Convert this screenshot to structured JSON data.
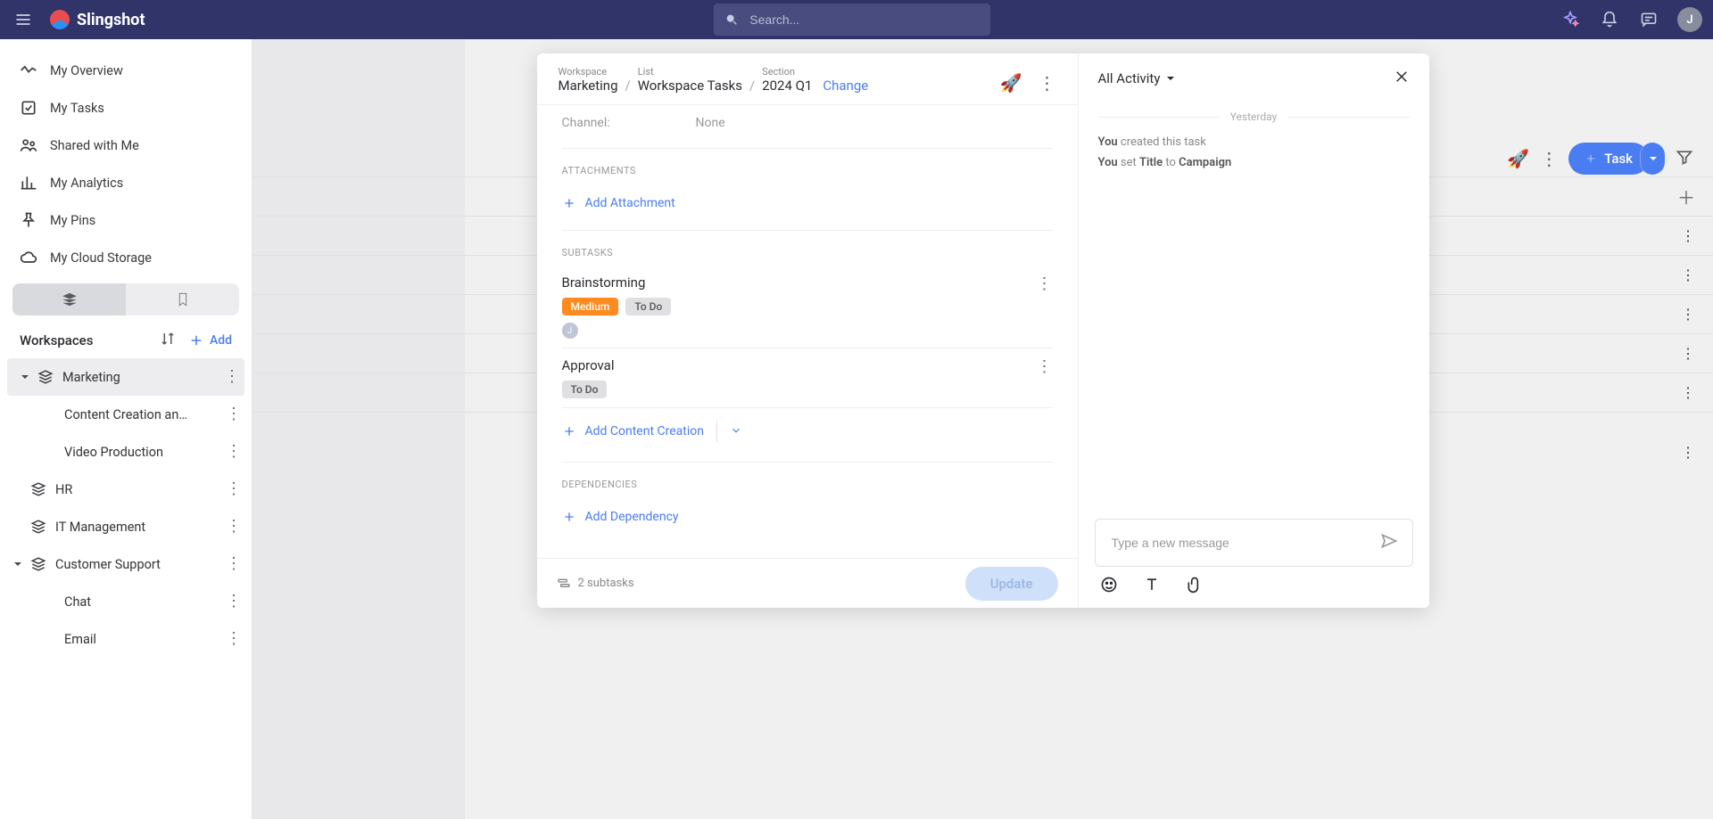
{
  "brand": {
    "name": "Slingshot"
  },
  "search": {
    "placeholder": "Search..."
  },
  "user": {
    "initial": "J"
  },
  "nav": [
    {
      "label": "My Overview",
      "icon": "activity"
    },
    {
      "label": "My Tasks",
      "icon": "check-square"
    },
    {
      "label": "Shared with Me",
      "icon": "users"
    },
    {
      "label": "My Analytics",
      "icon": "bar-chart"
    },
    {
      "label": "My Pins",
      "icon": "pin"
    },
    {
      "label": "My Cloud Storage",
      "icon": "cloud"
    }
  ],
  "workspaces_header": {
    "title": "Workspaces",
    "add": "Add"
  },
  "workspaces": [
    {
      "label": "Marketing",
      "expanded": true,
      "active": true,
      "children": [
        {
          "label": "Content Creation an…"
        },
        {
          "label": "Video Production"
        }
      ]
    },
    {
      "label": "HR",
      "expanded": false,
      "children": []
    },
    {
      "label": "IT Management",
      "expanded": false,
      "children": []
    },
    {
      "label": "Customer Support",
      "expanded": true,
      "children": [
        {
          "label": "Chat"
        },
        {
          "label": "Email"
        }
      ]
    }
  ],
  "bg_toolbar": {
    "task_button": "Task"
  },
  "modal": {
    "breadcrumb": {
      "workspace_label": "Workspace",
      "workspace": "Marketing",
      "list_label": "List",
      "list": "Workspace Tasks",
      "section_label": "Section",
      "section": "2024 Q1"
    },
    "change": "Change",
    "fields": {
      "channel_label": "Channel:",
      "channel_value": "None"
    },
    "sections": {
      "attachments": "ATTACHMENTS",
      "add_attachment": "Add Attachment",
      "subtasks": "SUBTASKS",
      "dependencies": "DEPENDENCIES",
      "add_dependency": "Add Dependency"
    },
    "subtasks": [
      {
        "name": "Brainstorming",
        "priority": "Medium",
        "status": "To Do",
        "assignee": "J"
      },
      {
        "name": "Approval",
        "status": "To Do"
      }
    ],
    "add_subtask": "Add Content Creation",
    "footer": {
      "subtask_count": "2 subtasks",
      "update": "Update"
    }
  },
  "activity": {
    "dropdown": "All Activity",
    "date": "Yesterday",
    "log": [
      {
        "who": "You",
        "rest": " created this task"
      },
      {
        "who": "You",
        "mid": " set ",
        "field": "Title",
        "to": " to ",
        "value": "Campaign"
      }
    ],
    "compose_placeholder": "Type a new message"
  }
}
